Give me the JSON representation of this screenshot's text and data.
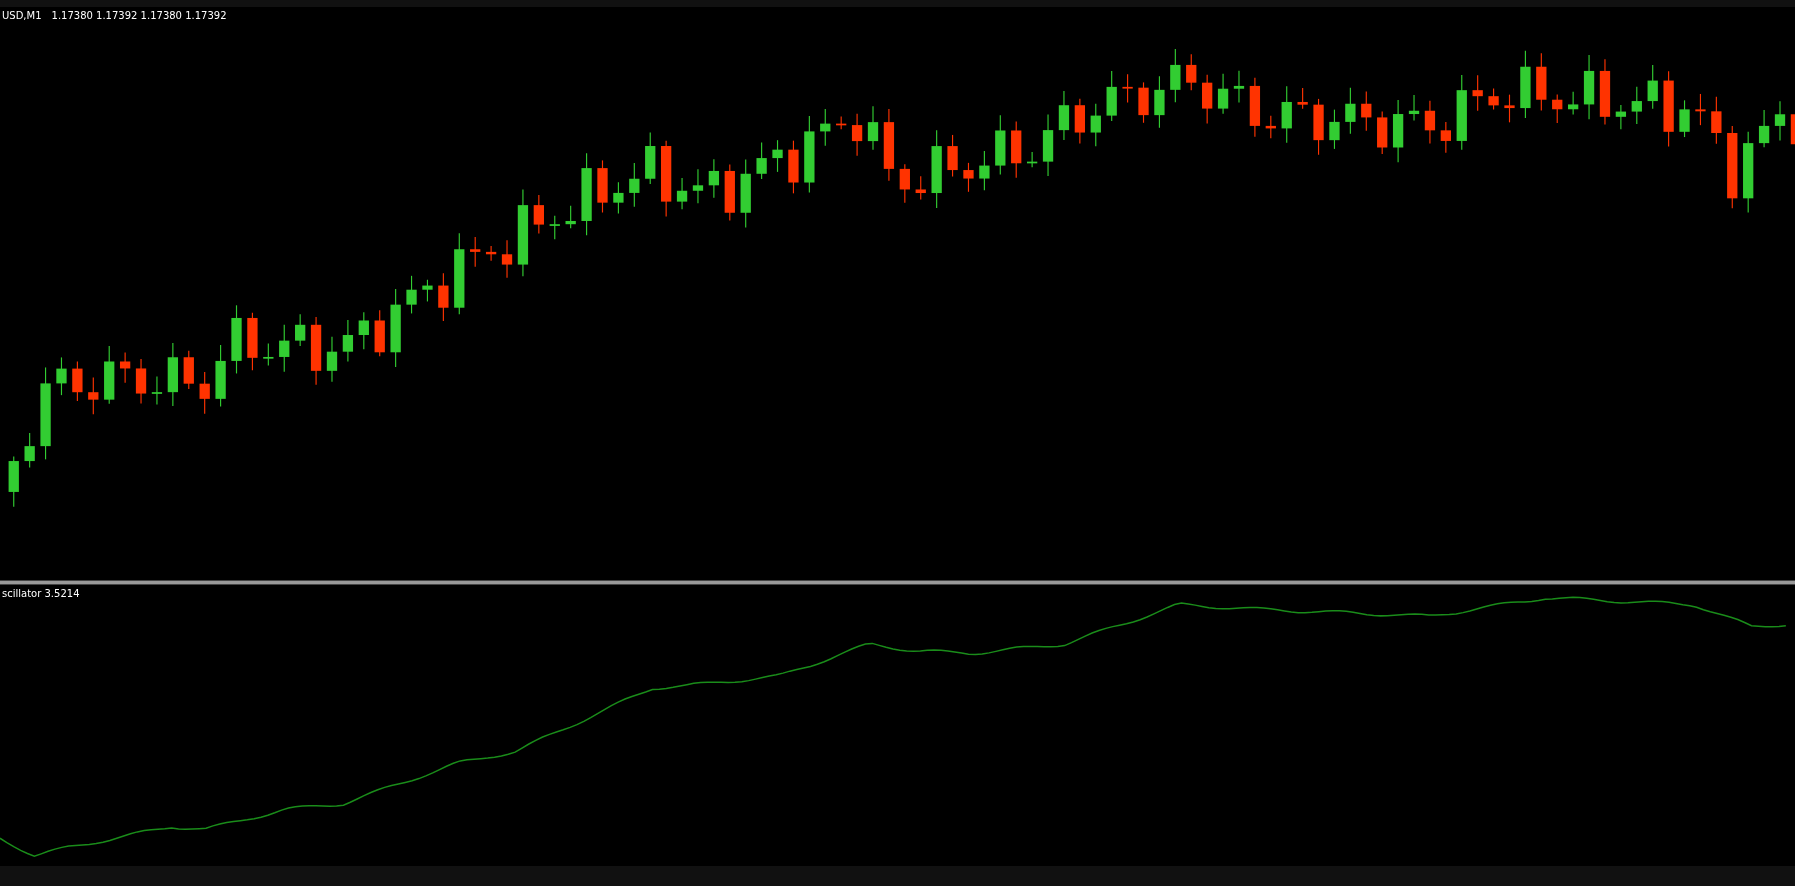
{
  "main_chart": {
    "symbol": "USD,M1",
    "quote": "1.17380 1.17392 1.17380 1.17392"
  },
  "indicator_panel": {
    "legend": "scillator 3.5214"
  }
}
